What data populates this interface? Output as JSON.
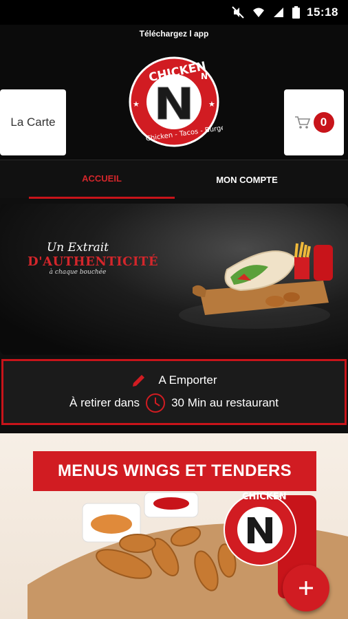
{
  "status_bar": {
    "time": "15:18"
  },
  "header": {
    "download_text": "Téléchargez l app",
    "carte_label": "La Carte",
    "cart_count": "0",
    "logo": {
      "brand": "CHICKEN N",
      "tagline": "Chicken - Tacos - Burger",
      "letter": "N"
    }
  },
  "tabs": [
    {
      "label": "ACCUEIL",
      "active": true
    },
    {
      "label": "MON COMPTE",
      "active": false
    }
  ],
  "banner": {
    "line1": "Un Extrait",
    "line2": "D'AUTHENTICITÉ",
    "line3": "à chaque bouchée"
  },
  "order": {
    "mode": "A Emporter",
    "pickup_prefix": "À retirer dans",
    "pickup_time": "30 Min au restaurant"
  },
  "menu_card": {
    "title": "MENUS WINGS ET TENDERS"
  },
  "colors": {
    "accent": "#c8141a",
    "background": "#0f0f0f"
  }
}
